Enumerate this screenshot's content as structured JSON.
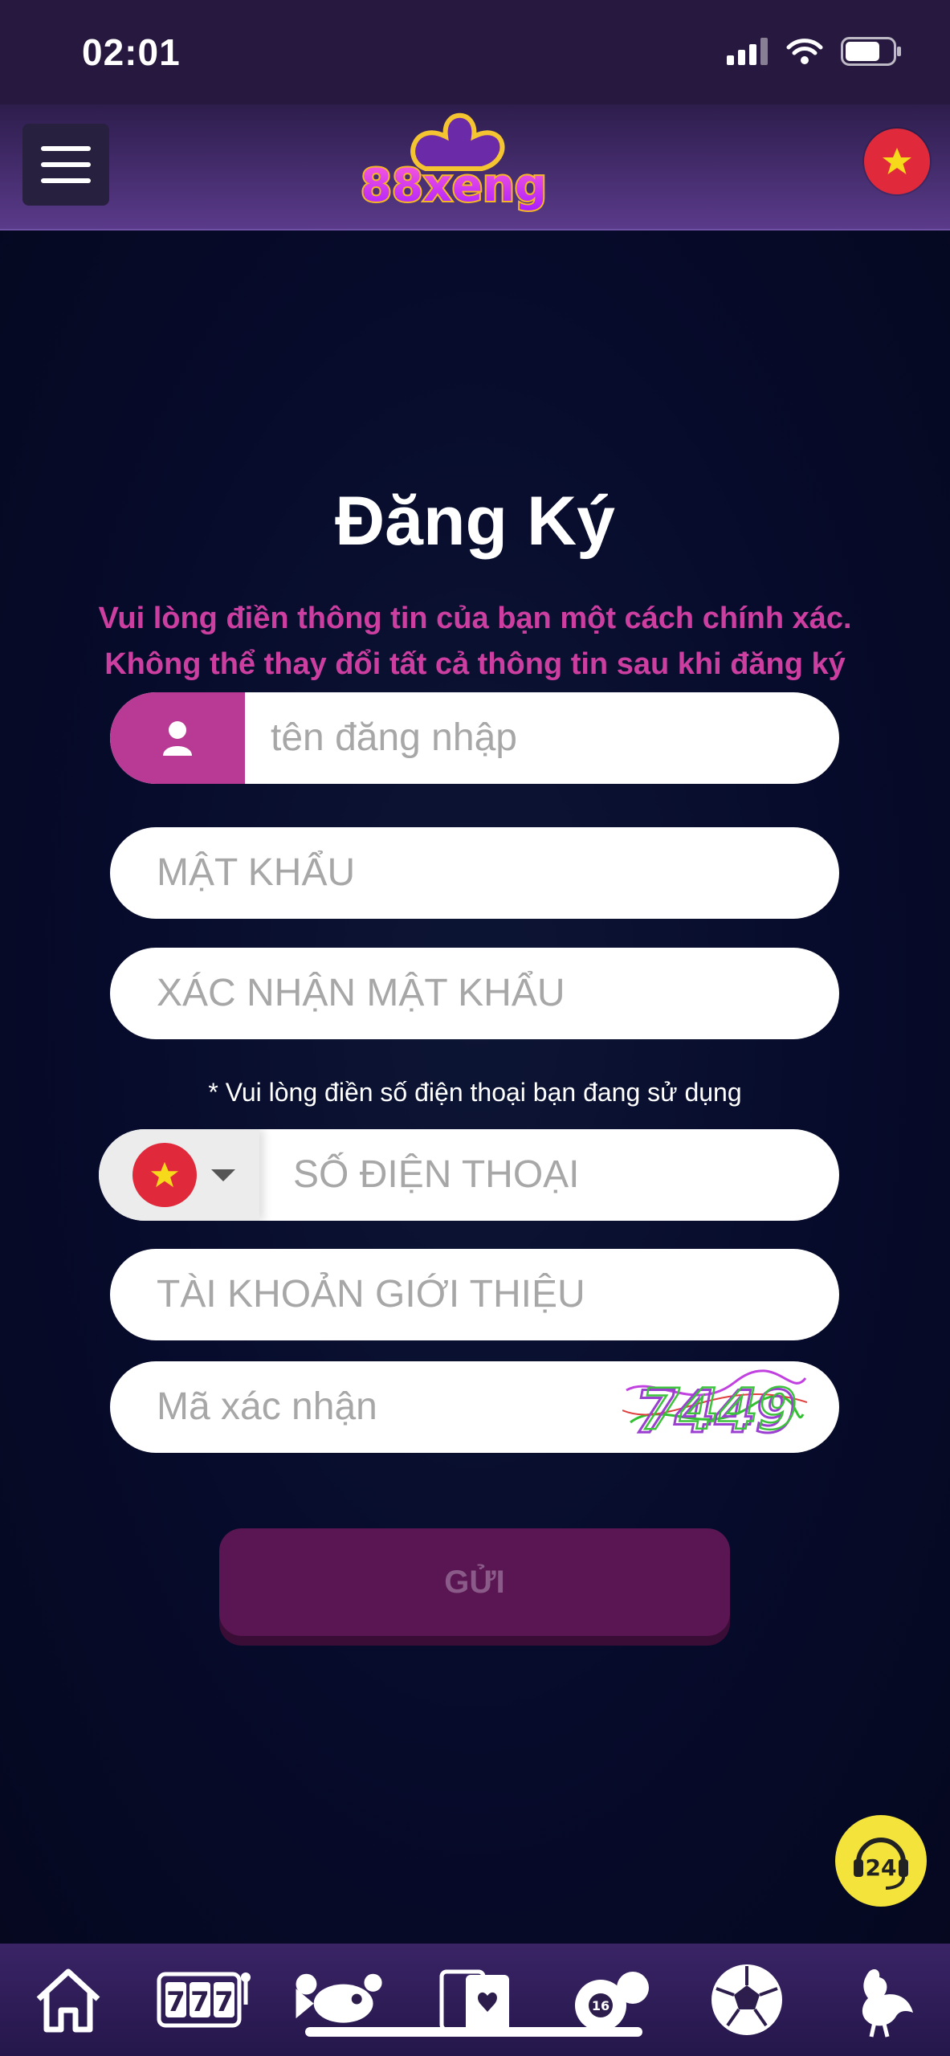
{
  "status_bar": {
    "time": "02:01"
  },
  "header": {
    "logo_text": "88xeng"
  },
  "form": {
    "title": "Đăng Ký",
    "subtitle_line1": "Vui lòng điền thông tin của bạn một cách chính xác.",
    "subtitle_line2": "Không thể thay đổi tất cả thông tin sau khi đăng ký",
    "username_placeholder": "tên đăng nhập",
    "password_placeholder": "MẬT KHẨU",
    "confirm_password_placeholder": "XÁC NHẬN MẬT KHẨU",
    "phone_note": "* Vui lòng điền số điện thoại bạn đang sử dụng",
    "phone_placeholder": "SỐ ĐIỆN THOẠI",
    "referral_placeholder": "TÀI KHOẢN GIỚI THIỆU",
    "captcha_placeholder": "Mã xác nhận",
    "captcha_code": "7449",
    "submit_label": "GỬI"
  },
  "support": {
    "label": "24"
  },
  "bottom_nav": {
    "items": [
      {
        "icon": "home-icon"
      },
      {
        "icon": "slots-777-icon"
      },
      {
        "icon": "fish-game-icon"
      },
      {
        "icon": "cards-icon"
      },
      {
        "icon": "lottery-balls-icon",
        "badge": "16"
      },
      {
        "icon": "soccer-ball-icon"
      },
      {
        "icon": "rooster-icon"
      }
    ]
  },
  "colors": {
    "accent_pink": "#cc3fa0",
    "submit_bg": "#5a1652",
    "header_top": "#2d1d4c",
    "flag_red": "#e02a3b",
    "star_yellow": "#f7d91c"
  }
}
